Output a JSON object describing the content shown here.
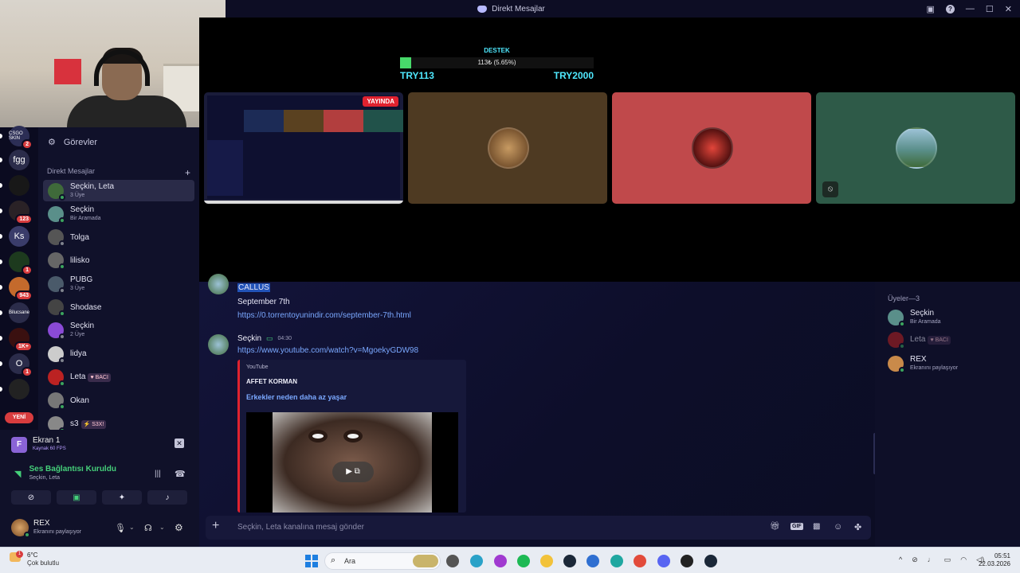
{
  "window": {
    "title": "Direkt Mesajlar"
  },
  "stream_overlay": {
    "label": "DESTEK",
    "progress_text": "113₺ (5.65%)",
    "progress_fraction": 0.0565,
    "current": "TRY113",
    "goal": "TRY2000"
  },
  "live_badge": "YAYINDA",
  "servers": [
    {
      "label": "CSGO SKIN",
      "badge": "2"
    },
    {
      "label": "fgg",
      "badge": ""
    },
    {
      "label": "",
      "badge": ""
    },
    {
      "label": "",
      "badge": "123"
    },
    {
      "label": "Ks",
      "badge": ""
    },
    {
      "label": "",
      "badge": "1"
    },
    {
      "label": "",
      "badge": "943"
    },
    {
      "label": "Bilucsane",
      "badge": ""
    },
    {
      "label": "",
      "badge": "1K+"
    },
    {
      "label": "O",
      "badge": "1"
    },
    {
      "label": "",
      "badge": ""
    }
  ],
  "new_label": "YENİ",
  "sidebar": {
    "tasks": "Görevler",
    "dm_header": "Direkt Mesajlar",
    "add": "+",
    "dms": [
      {
        "name": "Seçkin, Leta",
        "sub": "3 Üye",
        "tag": ""
      },
      {
        "name": "Seçkin",
        "sub": "Bir Aramada",
        "tag": ""
      },
      {
        "name": "Tolga",
        "sub": "",
        "tag": ""
      },
      {
        "name": "lilisko",
        "sub": "",
        "tag": ""
      },
      {
        "name": "PUBG",
        "sub": "3 Üye",
        "tag": ""
      },
      {
        "name": "Shodase",
        "sub": "",
        "tag": ""
      },
      {
        "name": "Seçkin",
        "sub": "2 Üye",
        "tag": ""
      },
      {
        "name": "lidya",
        "sub": "",
        "tag": ""
      },
      {
        "name": "Leta",
        "sub": "",
        "tag": "♥ BACI"
      },
      {
        "name": "Okan",
        "sub": "",
        "tag": ""
      },
      {
        "name": "s3",
        "sub": "",
        "tag": "⚡ S3X!"
      }
    ]
  },
  "voice": {
    "screen_title": "Ekran 1",
    "screen_sub": "Kaynak 60 FPS",
    "conn_title": "Ses Bağlantısı Kuruldu",
    "conn_sub": "Seçkin, Leta",
    "user_name": "REX",
    "user_status": "Ekranını paylaşıyor"
  },
  "chat": {
    "msg1_author": "CALLUS",
    "msg1_text": "September 7th",
    "msg1_link": "https://0.torrentoyunindir.com/september-7th.html",
    "msg2_author": "Seçkin",
    "msg2_time": "04:30",
    "msg2_link": "https://www.youtube.com/watch?v=MgoekyGDW98",
    "embed_provider": "YouTube",
    "embed_author": "AFFET KORMAN",
    "embed_title": "Erkekler neden daha az yaşar",
    "composer_placeholder": "Seçkin, Leta kanalına mesaj gönder"
  },
  "members": {
    "header": "Üyeler—3",
    "list": [
      {
        "name": "Seçkin",
        "sub": "Bir Aramada",
        "tag": ""
      },
      {
        "name": "Leta",
        "sub": "",
        "tag": "♥ BACI"
      },
      {
        "name": "REX",
        "sub": "Ekranını paylaşıyor",
        "tag": ""
      }
    ]
  },
  "taskbar": {
    "weather_temp": "6°C",
    "weather_desc": "Çok bulutlu",
    "search": "Ara",
    "time": "05:51",
    "date": "22.03.2026"
  },
  "colors": {
    "accent": "#5865f2",
    "online": "#3ba55d",
    "live": "#e0222f",
    "progress": "#47d96a"
  }
}
